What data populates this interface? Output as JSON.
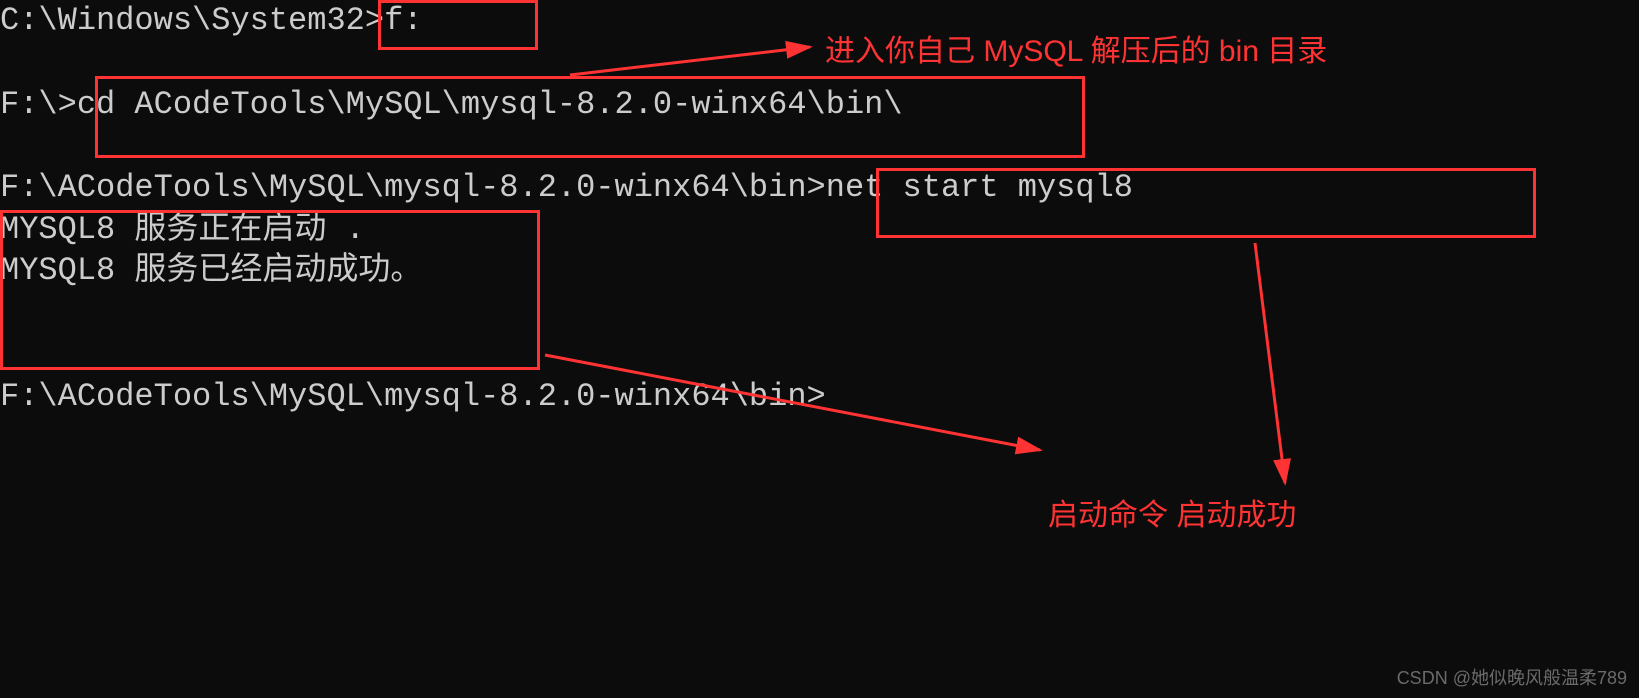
{
  "terminal": {
    "line1_prompt": "C:\\Windows\\System32>",
    "line1_cmd": "f:",
    "line2_prompt": "F:\\>",
    "line2_cmd": "cd ACodeTools\\MySQL\\mysql-8.2.0-winx64\\bin\\",
    "line3_prompt": "F:\\ACodeTools\\MySQL\\mysql-8.2.0-winx64\\bin>",
    "line3_cmd": "net start mysql8",
    "line4": "MYSQL8 服务正在启动 .",
    "line5": "MYSQL8 服务已经启动成功。",
    "line6_prompt": "F:\\ACodeTools\\MySQL\\mysql-8.2.0-winx64\\bin>"
  },
  "annotations": {
    "note1": "进入你自己 MySQL 解压后的 bin 目录",
    "note2": "启动命令 启动成功"
  },
  "watermark": "CSDN @她似晚风般温柔789"
}
